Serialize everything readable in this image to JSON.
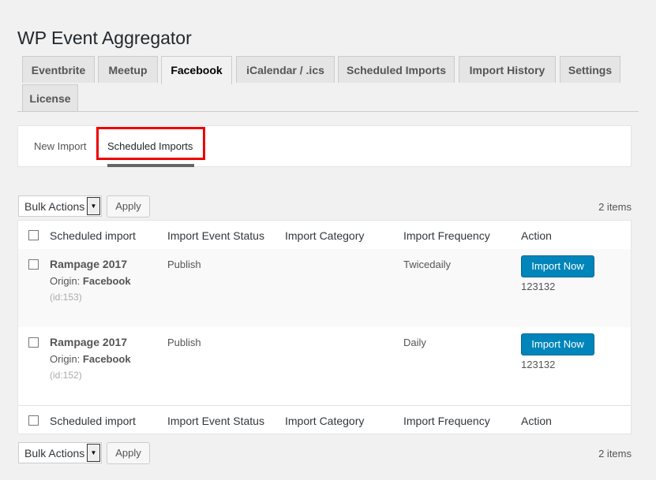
{
  "page": {
    "title": "WP Event Aggregator"
  },
  "nav_tabs": [
    {
      "label": "Eventbrite"
    },
    {
      "label": "Meetup"
    },
    {
      "label": "Facebook"
    },
    {
      "label": "iCalendar / .ics"
    },
    {
      "label": "Scheduled Imports"
    },
    {
      "label": "Import History"
    },
    {
      "label": "Settings"
    },
    {
      "label": "License"
    }
  ],
  "nav_tabs_active": "Facebook",
  "subnav": {
    "items": [
      {
        "label": "New Import"
      },
      {
        "label": "Scheduled Imports"
      }
    ],
    "active": "Scheduled Imports",
    "highlight_color": "#ee0000"
  },
  "bulk": {
    "select_label": "Bulk Actions",
    "apply_label": "Apply",
    "count": "2 items"
  },
  "table": {
    "columns": [
      "Scheduled import",
      "Import Event Status",
      "Import Category",
      "Import Frequency",
      "Action"
    ],
    "rows": [
      {
        "title": "Rampage 2017",
        "origin_prefix": "Origin:",
        "origin": "Facebook",
        "id": "(id:153)",
        "status": "Publish",
        "category": "",
        "frequency": "Twicedaily",
        "action_label": "Import Now",
        "action_meta": "123132"
      },
      {
        "title": "Rampage 2017",
        "origin_prefix": "Origin:",
        "origin": "Facebook",
        "id": "(id:152)",
        "status": "Publish",
        "category": "",
        "frequency": "Daily",
        "action_label": "Import Now",
        "action_meta": "123132"
      }
    ]
  },
  "colors": {
    "primary_button": "#0085ba",
    "background": "#f1f1f1"
  }
}
